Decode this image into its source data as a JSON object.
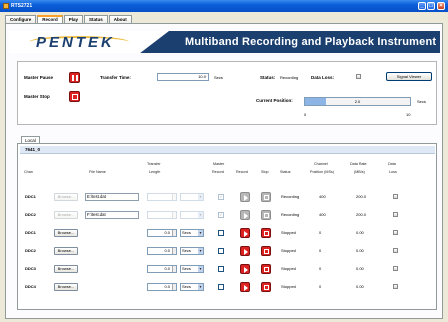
{
  "window": {
    "title": "RTS2721"
  },
  "tabs": [
    {
      "label": "Configure",
      "active": false
    },
    {
      "label": "Record",
      "active": true
    },
    {
      "label": "Play",
      "active": false
    },
    {
      "label": "Status",
      "active": false
    },
    {
      "label": "About",
      "active": false
    }
  ],
  "header": {
    "logo": "PENTEK",
    "title": "Multiband Recording and Playback Instrument"
  },
  "controls": {
    "master_pause_label": "Master Pause",
    "master_stop_label": "Master Stop",
    "transfer_time_label": "Transfer Time:",
    "transfer_time_value": "10.0",
    "transfer_time_unit": "Secs",
    "status_label": "Status:",
    "status_value": "Recording",
    "data_loss_label": "Data Loss:",
    "signal_viewer_button": "Signal Viewer",
    "current_position_label": "Current Position:",
    "progress_fraction": 0.2,
    "progress_value": "2.0",
    "progress_unit": "Secs",
    "progress_min": "0",
    "progress_max": "10"
  },
  "local_tab": "Local",
  "sub_tab": "7641_0",
  "columns": {
    "chan": "Chan",
    "file_name": "File Name",
    "transfer_length": [
      "Transfer",
      "Length"
    ],
    "master_record": [
      "Master",
      "Record"
    ],
    "record": "Record",
    "stop": "Stop",
    "status": "Status",
    "channel_position": [
      "Channel",
      "Position (MSs)"
    ],
    "data_rate": [
      "Data Rate",
      "(MB/s)"
    ],
    "data_loss": [
      "Data",
      "Loss"
    ]
  },
  "browse_label": "Browse...",
  "rows": [
    {
      "chan": "DDC1",
      "file": "E:\\test.dat",
      "length": "",
      "unit": "",
      "master": true,
      "status": "Recording",
      "position": "400",
      "rate": "200.0",
      "active": true
    },
    {
      "chan": "DDC2",
      "file": "F:\\test.dat",
      "length": "",
      "unit": "",
      "master": true,
      "status": "Recording",
      "position": "400",
      "rate": "200.0",
      "active": true
    },
    {
      "chan": "DDC1",
      "file": "",
      "length": "0.0",
      "unit": "Secs",
      "master": false,
      "status": "Stopped",
      "position": "0",
      "rate": "0.00",
      "active": false
    },
    {
      "chan": "DDC2",
      "file": "",
      "length": "0.0",
      "unit": "Secs",
      "master": false,
      "status": "Stopped",
      "position": "0",
      "rate": "0.00",
      "active": false
    },
    {
      "chan": "DDC3",
      "file": "",
      "length": "0.0",
      "unit": "Secs",
      "master": false,
      "status": "Stopped",
      "position": "0",
      "rate": "0.00",
      "active": false
    },
    {
      "chan": "DDC4",
      "file": "",
      "length": "0.0",
      "unit": "Secs",
      "master": false,
      "status": "Stopped",
      "position": "0",
      "rate": "0.00",
      "active": false
    }
  ],
  "colors": {
    "accent": "#1b3f6f",
    "record_red": "#dd2222"
  }
}
